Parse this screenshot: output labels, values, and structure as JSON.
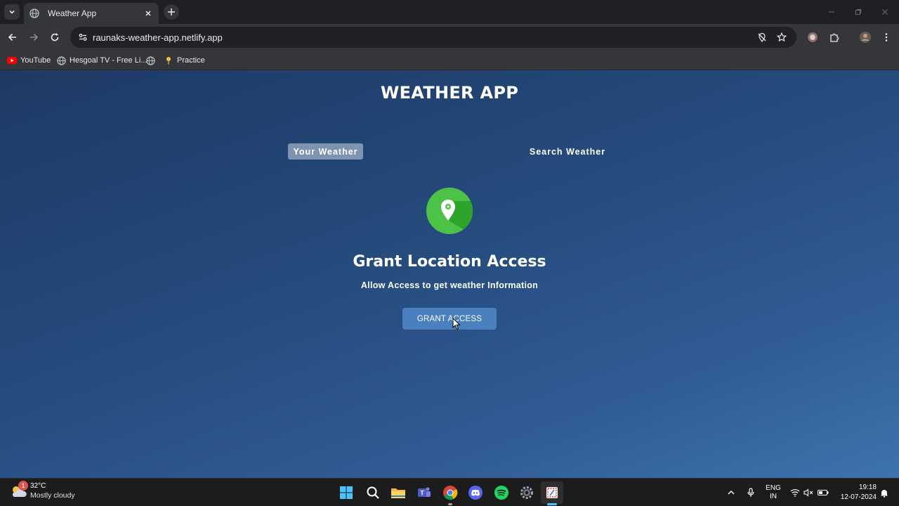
{
  "browser": {
    "tab_title": "Weather App",
    "url": "raunaks-weather-app.netlify.app",
    "bookmarks": [
      {
        "label": "YouTube",
        "icon": "youtube-icon"
      },
      {
        "label": "Hesgoal TV - Free Li...",
        "icon": "globe-icon"
      },
      {
        "label": "",
        "icon": "globe-icon"
      },
      {
        "label": "Practice",
        "icon": "bookmark-pin-icon"
      }
    ]
  },
  "app": {
    "title": "WEATHER APP",
    "tabs": {
      "your_weather": "Your Weather",
      "search_weather": "Search Weather"
    },
    "grant": {
      "heading": "Grant Location Access",
      "subtitle": "Allow Access to get weather Information",
      "button": "GRANT ACCESS"
    },
    "colors": {
      "location_icon": "#4cc246",
      "button": "#4a7fc0"
    }
  },
  "taskbar": {
    "weather": {
      "temp": "32°C",
      "condition": "Mostly cloudy",
      "badge": "1"
    },
    "apps": [
      "windows-start-icon",
      "search-icon",
      "file-explorer-icon",
      "teams-icon",
      "chrome-icon",
      "discord-icon",
      "spotify-icon",
      "settings-icon",
      "snipping-tool-icon"
    ],
    "language": {
      "lang": "ENG",
      "region": "IN"
    },
    "clock": {
      "time": "19:18",
      "date": "12-07-2024"
    }
  }
}
